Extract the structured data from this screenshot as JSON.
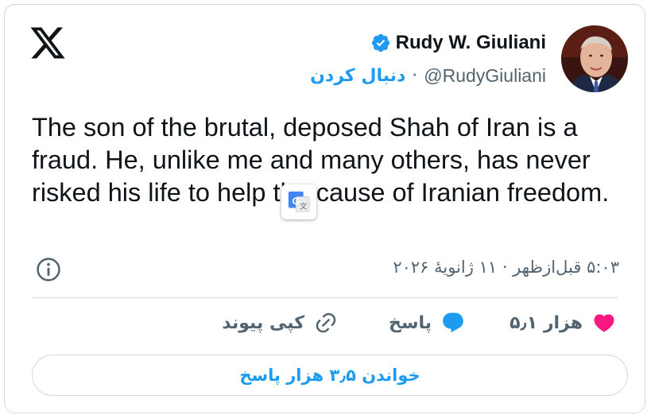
{
  "author": {
    "display_name": "Rudy W. Giuliani",
    "handle": "@RudyGiuliani",
    "verified": true,
    "follow_label": "دنبال کردن"
  },
  "tweet": {
    "text": "The son of the brutal, deposed Shah of Iran is a fraud. He, unlike me and many others, has never risked his life to help the cause of Iranian freedom.",
    "timestamp": "۵:۰۳ قبل‌ازظهر · ۱۱ ژانویهٔ ۲۰۲۶"
  },
  "actions": {
    "likes_count": "۵٫۱ هزار",
    "reply_label": "پاسخ",
    "copy_link_label": "کپی پیوند"
  },
  "read_replies_label": "خواندن ۳٫۵ هزار پاسخ",
  "colors": {
    "accent": "#1d9bf0",
    "like": "#f91880",
    "muted": "#536471",
    "text": "#0f1419",
    "border": "#cfd9de"
  },
  "icons": {
    "brand": "x-logo-icon",
    "verified": "verified-badge-icon",
    "info": "info-icon",
    "like": "heart-icon",
    "reply": "speech-bubble-icon",
    "copy": "link-icon",
    "translate": "google-translate-icon"
  }
}
